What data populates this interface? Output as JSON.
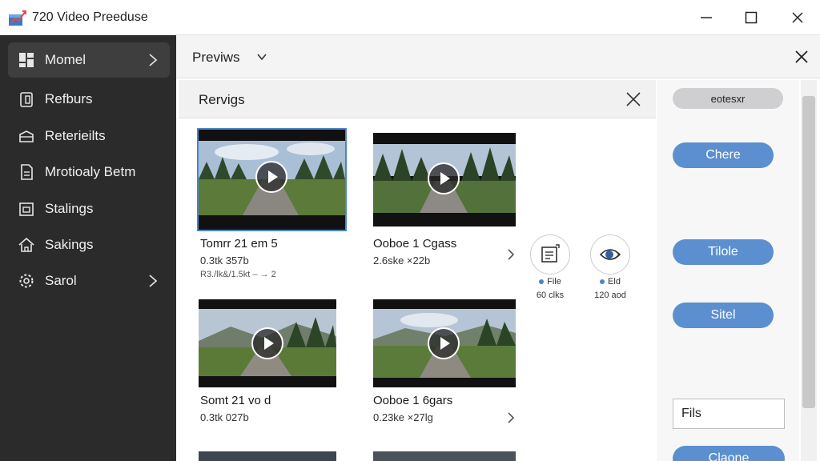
{
  "window": {
    "title": "720 Video Preeduse",
    "minimize": "—",
    "maximize": "☐",
    "close": "✕"
  },
  "sidebar": {
    "items": [
      {
        "label": "Momel",
        "icon": "dashboard-icon",
        "active": true,
        "chevron": true
      },
      {
        "label": "Refburs",
        "icon": "tablet-icon",
        "active": false,
        "chevron": false
      },
      {
        "label": "Reterieilts",
        "icon": "inbox-icon",
        "active": false,
        "chevron": false
      },
      {
        "label": "Mrotioaly Betm",
        "icon": "document-icon",
        "active": false,
        "chevron": false
      },
      {
        "label": "Stalings",
        "icon": "calendar-icon",
        "active": false,
        "chevron": false
      },
      {
        "label": "Sakings",
        "icon": "home-icon",
        "active": false,
        "chevron": false
      },
      {
        "label": "Sarol",
        "icon": "gear-icon",
        "active": false,
        "chevron": true
      }
    ]
  },
  "main": {
    "preview_label": "Previws",
    "panel_title": "Rervigs",
    "videos": [
      {
        "name": "Tomrr 21 em 5",
        "size": "0.3tk 357b",
        "meta": "R3./lk&/1.5kt  –  → 2"
      },
      {
        "name": "Ooboe 1 Cgass",
        "size": "2.6ske ×22b",
        "meta": ""
      },
      {
        "name": "Somt 21 vo d",
        "size": "0.3tk 027b",
        "meta": ""
      },
      {
        "name": "Ooboe 1 6gars",
        "size": "0.23ke ×27lg",
        "meta": ""
      }
    ],
    "file_actions": [
      {
        "label": "File",
        "sub": "60 clks",
        "icon": "file-icon"
      },
      {
        "label": "Eld",
        "sub": "120 aod",
        "icon": "eye-icon"
      }
    ]
  },
  "right_panel": {
    "top_button": "eotesxr",
    "buttons": [
      "Chere",
      "Tilole",
      "Sitel"
    ],
    "field_value": "Fils",
    "bottom_button": "Claone"
  },
  "colors": {
    "sidebar_bg": "#2b2b2b",
    "accent_blue": "#5b8fd0",
    "selected_outline": "#4a86c5"
  }
}
